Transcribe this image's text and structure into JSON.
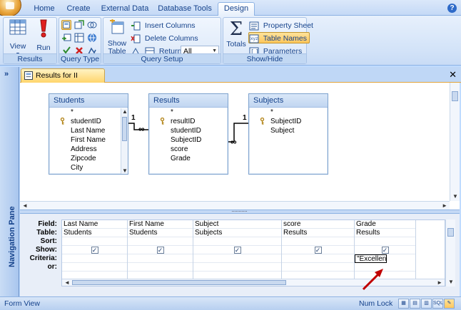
{
  "ribbon_tabs": [
    "Home",
    "Create",
    "External Data",
    "Database Tools",
    "Design"
  ],
  "active_tab": "Design",
  "groups": {
    "results": {
      "label": "Results",
      "view": "View",
      "run": "Run"
    },
    "query_type": {
      "label": "Query Type"
    },
    "query_setup": {
      "label": "Query Setup",
      "show_table": "Show Table",
      "insert_columns": "Insert Columns",
      "delete_columns": "Delete Columns",
      "return_label": "Return:",
      "return_value": "All"
    },
    "show_hide": {
      "label": "Show/Hide",
      "totals": "Totals",
      "property_sheet": "Property Sheet",
      "table_names": "Table Names",
      "parameters": "Parameters"
    }
  },
  "nav_pane": {
    "label": "Navigation Pane"
  },
  "document_tab": "Results for II Subject",
  "tables": [
    {
      "title": "Students",
      "fields": [
        "*",
        "studentID",
        "Last Name",
        "First Name",
        "Address",
        "Zipcode",
        "City"
      ]
    },
    {
      "title": "Results",
      "fields": [
        "*",
        "resultID",
        "studentID",
        "SubjectID",
        "score",
        "Grade"
      ]
    },
    {
      "title": "Subjects",
      "fields": [
        "*",
        "SubjectID",
        "Subject"
      ]
    }
  ],
  "joins": {
    "one": "1",
    "many": "∞"
  },
  "grid": {
    "row_labels": [
      "Field:",
      "Table:",
      "Sort:",
      "Show:",
      "Criteria:",
      "or:"
    ],
    "columns": [
      {
        "field": "Last Name",
        "table": "Students",
        "show": "✓",
        "criteria": ""
      },
      {
        "field": "First Name",
        "table": "Students",
        "show": "✓",
        "criteria": ""
      },
      {
        "field": "Subject",
        "table": "Subjects",
        "show": "✓",
        "criteria": ""
      },
      {
        "field": "score",
        "table": "Results",
        "show": "✓",
        "criteria": ""
      },
      {
        "field": "Grade",
        "table": "Results",
        "show": "✓",
        "criteria": "\"Excellent\""
      }
    ]
  },
  "status": {
    "left": "Form View",
    "right": "Num Lock",
    "view_buttons": [
      "",
      "",
      "",
      "SQL",
      ""
    ]
  },
  "colors": {
    "accent_orange": "#ffc75c",
    "annotation_arrow": "#c00000",
    "ribbon_text": "#15428b"
  }
}
